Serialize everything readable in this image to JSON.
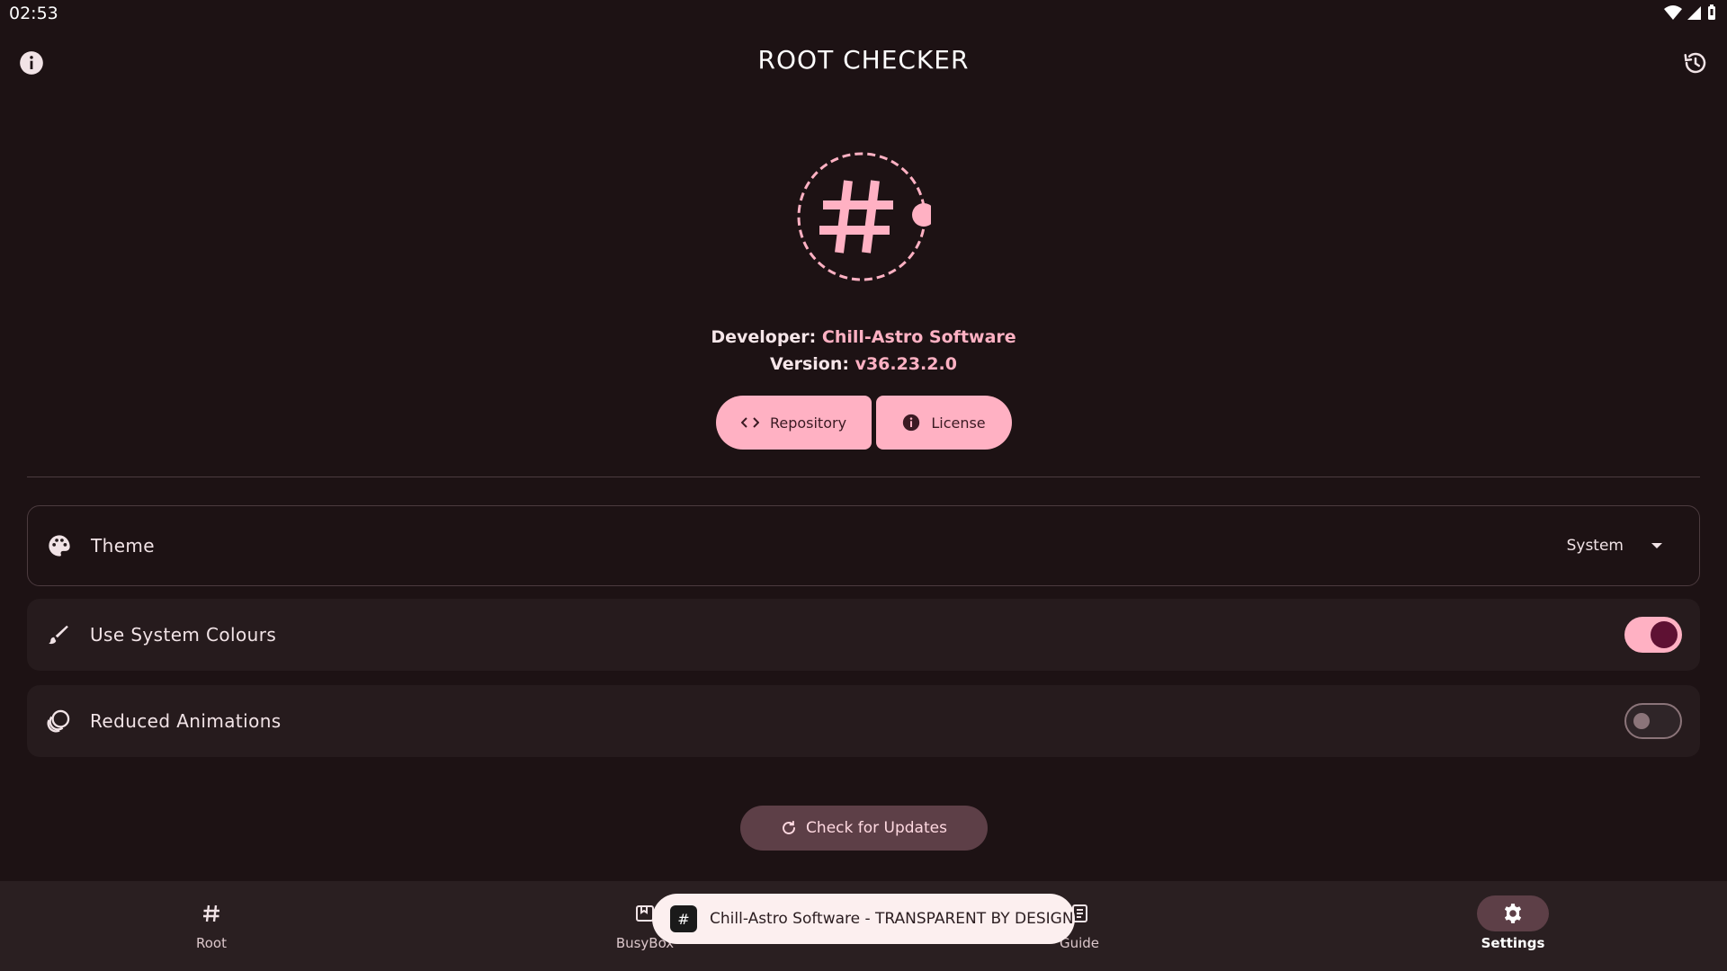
{
  "status_bar": {
    "time": "02:53"
  },
  "header": {
    "title": "ROOT  CHECKER"
  },
  "about": {
    "developer_label": "Developer:",
    "developer_value": "Chill-Astro Software",
    "version_label": "Version:",
    "version_value": "v36.23.2.0",
    "repository_label": "Repository",
    "license_label": "License"
  },
  "settings": {
    "theme": {
      "label": "Theme",
      "value": "System"
    },
    "system_colours": {
      "label": "Use System Colours",
      "enabled": true
    },
    "reduced_animations": {
      "label": "Reduced Animations",
      "enabled": false
    }
  },
  "update_button_label": "Check for Updates",
  "nav": {
    "items": [
      {
        "label": "Root",
        "icon": "hash-icon",
        "active": false
      },
      {
        "label": "BusyBox",
        "icon": "box-icon",
        "active": false
      },
      {
        "label": "Guide",
        "icon": "book-icon",
        "active": false
      },
      {
        "label": "Settings",
        "icon": "gear-icon",
        "active": true
      }
    ]
  },
  "toast": {
    "text": "Chill-Astro Software - TRANSPARENT BY DESIGN"
  },
  "colors": {
    "accent": "#ffb1c3",
    "background": "#1d1214",
    "surface": "#261b1d"
  }
}
